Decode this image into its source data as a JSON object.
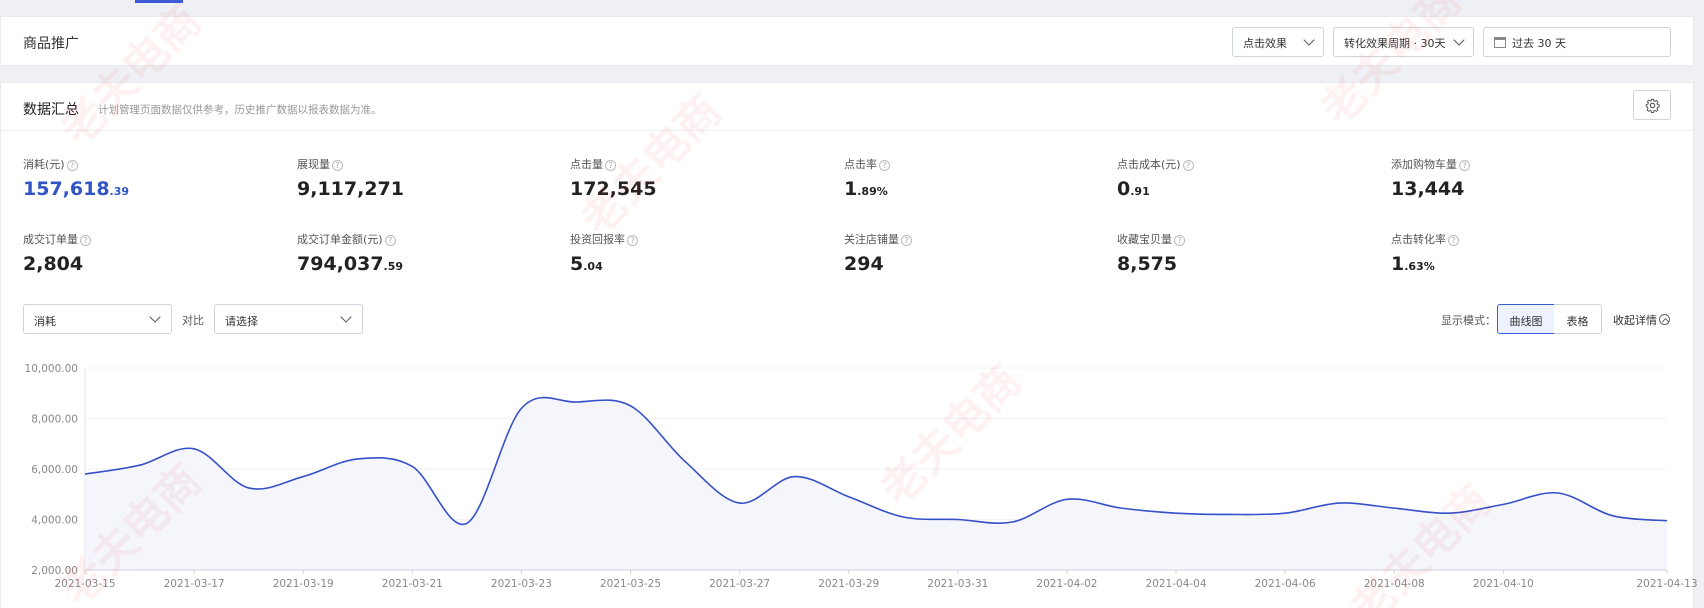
{
  "promo": {
    "title": "商品推广",
    "effect_select": "点击效果",
    "period_select": "转化效果周期 · 30天",
    "date_range": "过去 30 天"
  },
  "summary": {
    "title": "数据汇总",
    "note": "计划管理页面数据仅供参考，历史推广数据以报表数据为准。",
    "metrics": [
      {
        "label": "消耗(元)",
        "int": "157,618",
        "dec": ".39",
        "highlight": true
      },
      {
        "label": "展现量",
        "int": "9,117,271",
        "dec": ""
      },
      {
        "label": "点击量",
        "int": "172,545",
        "dec": ""
      },
      {
        "label": "点击率",
        "int": "1",
        "dec": ".89%"
      },
      {
        "label": "点击成本(元)",
        "int": "0",
        "dec": ".91"
      },
      {
        "label": "添加购物车量",
        "int": "13,444",
        "dec": ""
      },
      {
        "label": "成交订单量",
        "int": "2,804",
        "dec": ""
      },
      {
        "label": "成交订单金额(元)",
        "int": "794,037",
        "dec": ".59"
      },
      {
        "label": "投资回报率",
        "int": "5",
        "dec": ".04"
      },
      {
        "label": "关注店铺量",
        "int": "294",
        "dec": ""
      },
      {
        "label": "收藏宝贝量",
        "int": "8,575",
        "dec": ""
      },
      {
        "label": "点击转化率",
        "int": "1",
        "dec": ".63%"
      }
    ]
  },
  "controls": {
    "metric_select": "消耗",
    "compare_label": "对比",
    "compare_select": "请选择",
    "mode_label": "显示模式：",
    "mode_chart": "曲线图",
    "mode_table": "表格",
    "collapse": "收起详情"
  },
  "watermark": "老夫电商",
  "colors": {
    "line": "#3550c8",
    "fill": "#f4f6fc",
    "accent": "#3b5bd9",
    "highlight": "#3054c5"
  },
  "chart_data": {
    "type": "area",
    "x": [
      "2021-03-15",
      "2021-03-16",
      "2021-03-17",
      "2021-03-18",
      "2021-03-19",
      "2021-03-20",
      "2021-03-21",
      "2021-03-22",
      "2021-03-23",
      "2021-03-24",
      "2021-03-25",
      "2021-03-26",
      "2021-03-27",
      "2021-03-28",
      "2021-03-29",
      "2021-03-30",
      "2021-03-31",
      "2021-04-01",
      "2021-04-02",
      "2021-04-03",
      "2021-04-04",
      "2021-04-05",
      "2021-04-06",
      "2021-04-07",
      "2021-04-08",
      "2021-04-09",
      "2021-04-10",
      "2021-04-11",
      "2021-04-12",
      "2021-04-13"
    ],
    "values": [
      5800,
      6150,
      6800,
      5250,
      5700,
      6400,
      6100,
      3850,
      8400,
      8650,
      8500,
      6300,
      4650,
      5700,
      4900,
      4100,
      4000,
      3900,
      4800,
      4450,
      4250,
      4200,
      4250,
      4650,
      4450,
      4250,
      4600,
      5050,
      4150,
      3950
    ],
    "xticks": [
      "2021-03-15",
      "2021-03-17",
      "2021-03-19",
      "2021-03-21",
      "2021-03-23",
      "2021-03-25",
      "2021-03-27",
      "2021-03-29",
      "2021-03-31",
      "2021-04-02",
      "2021-04-04",
      "2021-04-06",
      "2021-04-08",
      "2021-04-10",
      "2021-04-13"
    ],
    "yticks": [
      "2,000.00",
      "4,000.00",
      "6,000.00",
      "8,000.00",
      "10,000.00"
    ],
    "ylim": [
      2000,
      10000
    ],
    "grid": true
  }
}
